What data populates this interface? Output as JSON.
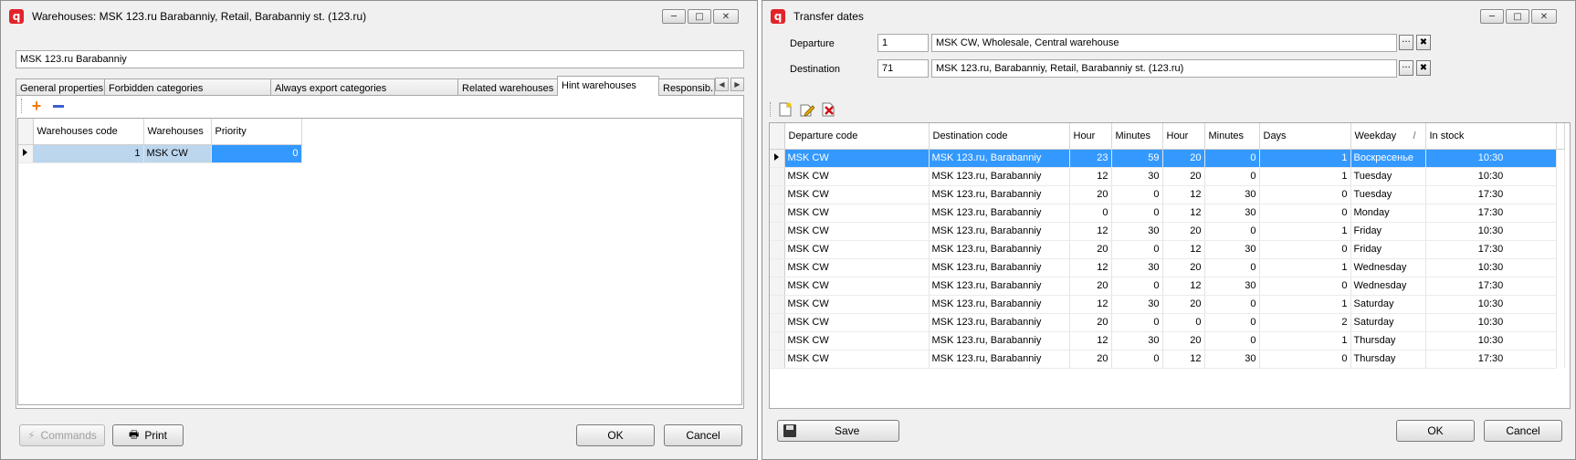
{
  "left_window": {
    "title": "Warehouses: MSK 123.ru Barabanniy, Retail, Barabanniy st. (123.ru)",
    "name_value": "MSK 123.ru Barabanniy",
    "tabs": [
      {
        "label": "General properties"
      },
      {
        "label": "Forbidden categories"
      },
      {
        "label": "Always export categories"
      },
      {
        "label": "Related warehouses"
      },
      {
        "label": "Hint warehouses"
      },
      {
        "label": "Responsib.."
      }
    ],
    "grid": {
      "columns": [
        "Warehouses code",
        "Warehouses",
        "Priority"
      ],
      "rows": [
        {
          "code": "1",
          "warehouse": "MSK CW",
          "priority": "0"
        }
      ]
    },
    "commands_label": "Commands",
    "print_label": "Print",
    "ok_label": "OK",
    "cancel_label": "Cancel"
  },
  "right_window": {
    "title": "Transfer dates",
    "departure_label": "Departure",
    "departure_code": "1",
    "departure_name": "MSK CW, Wholesale, Central warehouse",
    "destination_label": "Destination",
    "destination_code": "71",
    "destination_name": "MSK 123.ru, Barabanniy, Retail, Barabanniy st. (123.ru)",
    "grid": {
      "columns": [
        "Departure code",
        "Destination code",
        "Hour",
        "Minutes",
        "Hour",
        "Minutes",
        "Days",
        "Weekday",
        "In stock"
      ],
      "rows": [
        {
          "dep": "MSK CW",
          "dest": "MSK 123.ru, Barabanniy",
          "h1": "23",
          "m1": "59",
          "h2": "20",
          "m2": "0",
          "days": "1",
          "weekday": "Воскресенье",
          "stock": "10:30"
        },
        {
          "dep": "MSK CW",
          "dest": "MSK 123.ru, Barabanniy",
          "h1": "12",
          "m1": "30",
          "h2": "20",
          "m2": "0",
          "days": "1",
          "weekday": "Tuesday",
          "stock": "10:30"
        },
        {
          "dep": "MSK CW",
          "dest": "MSK 123.ru, Barabanniy",
          "h1": "20",
          "m1": "0",
          "h2": "12",
          "m2": "30",
          "days": "0",
          "weekday": "Tuesday",
          "stock": "17:30"
        },
        {
          "dep": "MSK CW",
          "dest": "MSK 123.ru, Barabanniy",
          "h1": "0",
          "m1": "0",
          "h2": "12",
          "m2": "30",
          "days": "0",
          "weekday": "Monday",
          "stock": "17:30"
        },
        {
          "dep": "MSK CW",
          "dest": "MSK 123.ru, Barabanniy",
          "h1": "12",
          "m1": "30",
          "h2": "20",
          "m2": "0",
          "days": "1",
          "weekday": "Friday",
          "stock": "10:30"
        },
        {
          "dep": "MSK CW",
          "dest": "MSK 123.ru, Barabanniy",
          "h1": "20",
          "m1": "0",
          "h2": "12",
          "m2": "30",
          "days": "0",
          "weekday": "Friday",
          "stock": "17:30"
        },
        {
          "dep": "MSK CW",
          "dest": "MSK 123.ru, Barabanniy",
          "h1": "12",
          "m1": "30",
          "h2": "20",
          "m2": "0",
          "days": "1",
          "weekday": "Wednesday",
          "stock": "10:30"
        },
        {
          "dep": "MSK CW",
          "dest": "MSK 123.ru, Barabanniy",
          "h1": "20",
          "m1": "0",
          "h2": "12",
          "m2": "30",
          "days": "0",
          "weekday": "Wednesday",
          "stock": "17:30"
        },
        {
          "dep": "MSK CW",
          "dest": "MSK 123.ru, Barabanniy",
          "h1": "12",
          "m1": "30",
          "h2": "20",
          "m2": "0",
          "days": "1",
          "weekday": "Saturday",
          "stock": "10:30"
        },
        {
          "dep": "MSK CW",
          "dest": "MSK 123.ru, Barabanniy",
          "h1": "20",
          "m1": "0",
          "h2": "0",
          "m2": "0",
          "days": "2",
          "weekday": "Saturday",
          "stock": "10:30"
        },
        {
          "dep": "MSK CW",
          "dest": "MSK 123.ru, Barabanniy",
          "h1": "12",
          "m1": "30",
          "h2": "20",
          "m2": "0",
          "days": "1",
          "weekday": "Thursday",
          "stock": "10:30"
        },
        {
          "dep": "MSK CW",
          "dest": "MSK 123.ru, Barabanniy",
          "h1": "20",
          "m1": "0",
          "h2": "12",
          "m2": "30",
          "days": "0",
          "weekday": "Thursday",
          "stock": "17:30"
        }
      ]
    },
    "save_label": "Save",
    "ok_label": "OK",
    "cancel_label": "Cancel"
  },
  "colors": {
    "selection": "#3399ff",
    "app_icon": "#e2242a"
  }
}
